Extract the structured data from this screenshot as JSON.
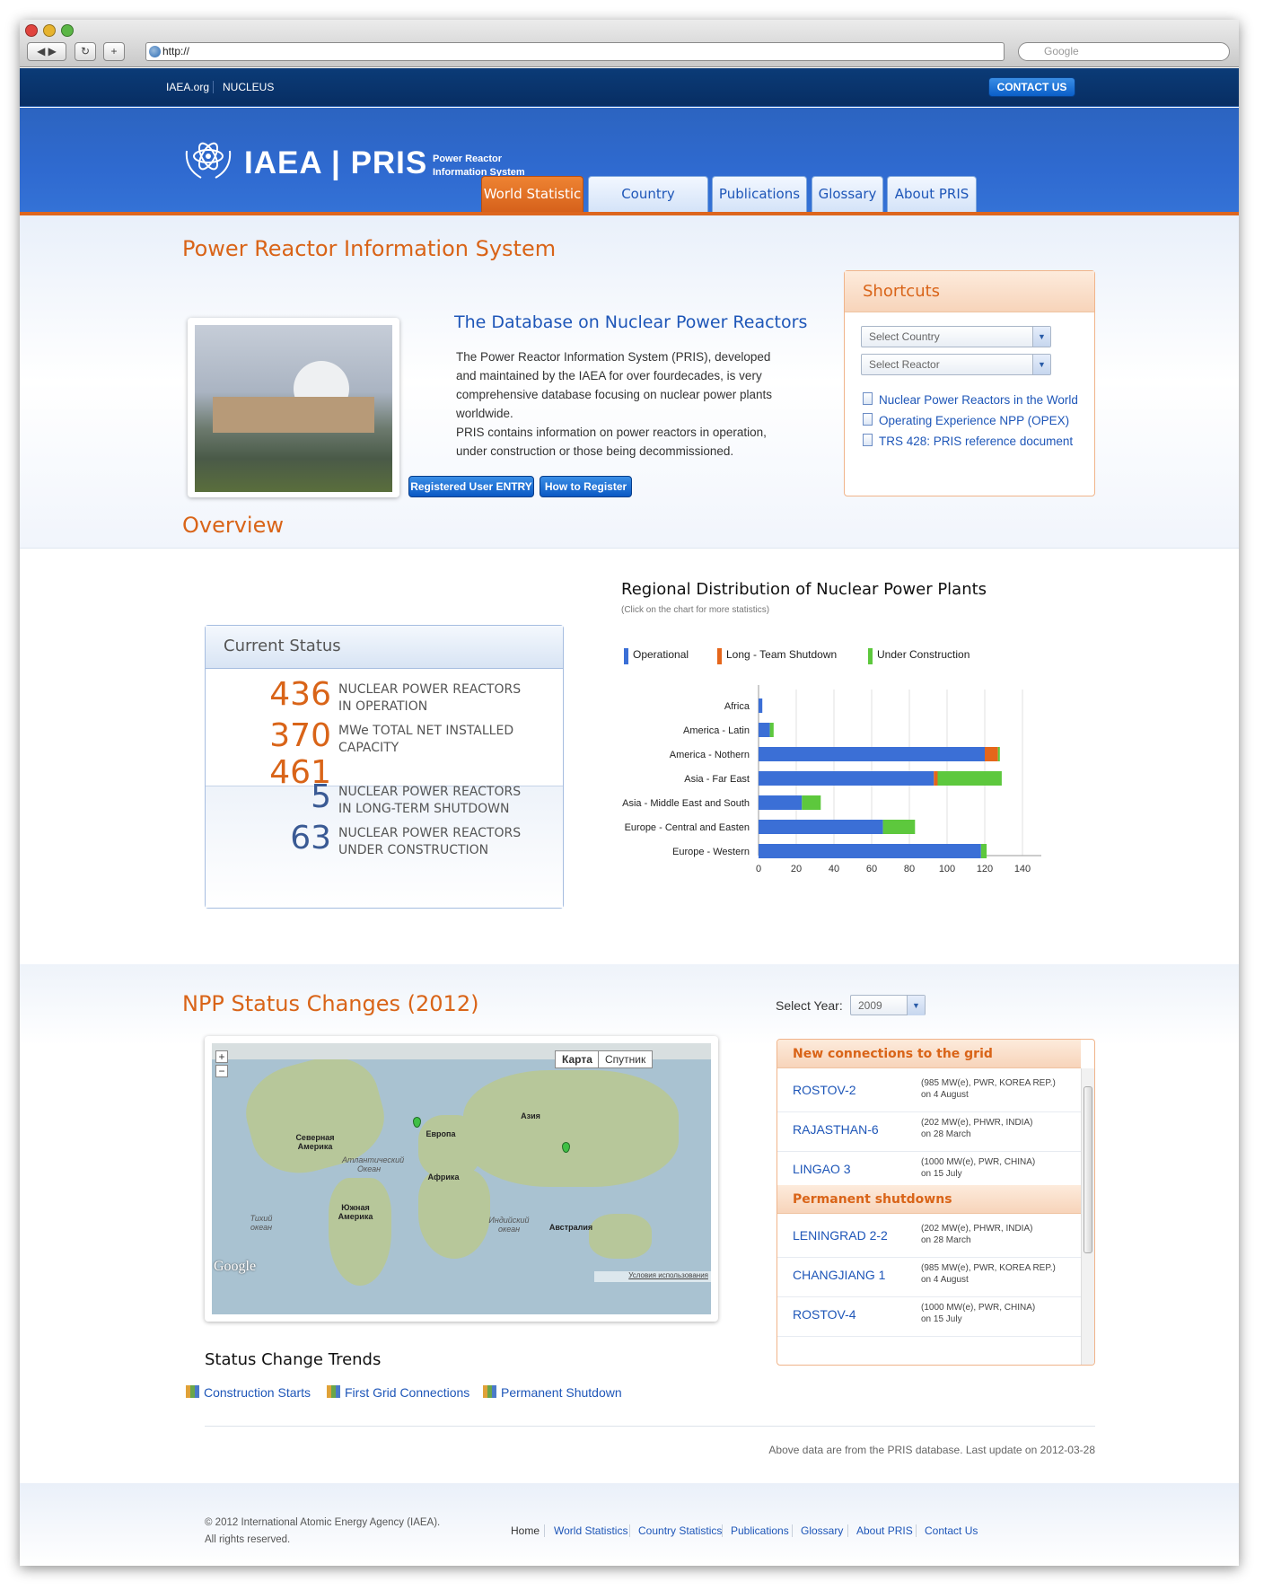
{
  "browser": {
    "url": "http://",
    "search_placeholder": "Google"
  },
  "topbar": {
    "links": [
      "IAEA.org",
      "NUCLEUS"
    ],
    "contact": "CONTACT US"
  },
  "header": {
    "logo": "IAEA | PRIS",
    "logo_sub": "Power Reactor Information System",
    "tabs": [
      "World Statistic",
      "Country Statistics",
      "Publications",
      "Glossary",
      "About PRIS"
    ],
    "active_tab": "World Statistic"
  },
  "intro": {
    "title": "Power Reactor Information System",
    "db_title": "The Database on Nuclear Power Reactors",
    "text1": "The Power Reactor Information System (PRIS), developed and maintained by the IAEA for over fourdecades, is very comprehensive database focusing on nuclear power plants worldwide.",
    "text2": "PRIS contains information on power reactors in operation, under construction or those being decommissioned.",
    "btn_register_entry": "Registered User ENTRY",
    "btn_how_to_register": "How to Register"
  },
  "shortcuts": {
    "title": "Shortcuts",
    "select_country": "Select Country",
    "select_reactor": "Select Reactor",
    "links": [
      "Nuclear Power Reactors in the World",
      "Operating Experience NPP (OPEX)",
      "TRS 428: PRIS reference document"
    ]
  },
  "overview": {
    "title": "Overview",
    "box_title": "Current Status",
    "stats": [
      {
        "num": "436",
        "label1": "NUCLEAR POWER REACTORS",
        "label2": "IN OPERATION"
      },
      {
        "num": "370 461",
        "label1": "MWe TOTAL NET INSTALLED",
        "label2": "CAPACITY"
      },
      {
        "num": "5",
        "label1": "NUCLEAR POWER REACTORS",
        "label2": "IN LONG-TERM SHUTDOWN"
      },
      {
        "num": "63",
        "label1": "NUCLEAR POWER REACTORS",
        "label2": "UNDER CONSTRUCTION"
      }
    ]
  },
  "chart_data": {
    "type": "bar",
    "stacked": true,
    "orientation": "horizontal",
    "title": "Regional Distribution of Nuclear Power Plants",
    "subtitle": "(Click on the chart for more statistics)",
    "categories": [
      "Africa",
      "America - Latin",
      "America - Nothern",
      "Asia - Far East",
      "Asia - Middle East and South",
      "Europe - Central and Easten",
      "Europe - Western"
    ],
    "series": [
      {
        "name": "Operational",
        "color": "#3b6fd6",
        "values": [
          2,
          6,
          120,
          93,
          23,
          66,
          118
        ]
      },
      {
        "name": "Long - Team Shutdown",
        "color": "#e5661b",
        "values": [
          0,
          0,
          7,
          2,
          0,
          0,
          0
        ]
      },
      {
        "name": "Under Construction",
        "color": "#5dc83d",
        "values": [
          0,
          2,
          1,
          34,
          10,
          17,
          3
        ]
      }
    ],
    "xlim": [
      0,
      150
    ],
    "xticks": [
      0,
      20,
      40,
      60,
      80,
      100,
      120,
      140
    ],
    "grid": true,
    "legend": "top"
  },
  "npp": {
    "title": "NPP Status Changes (2012)",
    "select_year_label": "Select Year:",
    "year": "2009",
    "map_btn_map": "Карта",
    "map_btn_sat": "Спутник",
    "map_terms": "Условия использования",
    "map_brand": "Google",
    "map_labels": [
      "Северная Америка",
      "Атлантический Океан",
      "Европа",
      "Азия",
      "Африка",
      "Южная Америка",
      "Тихий океан",
      "Индийский океан",
      "Австралия"
    ],
    "new_title": "New connections to the grid",
    "new": [
      {
        "name": "ROSTOV-2",
        "d1": "(985 MW(e), PWR, KOREA REP.)",
        "d2": "on 4 August"
      },
      {
        "name": "RAJASTHAN-6",
        "d1": "(202 MW(e), PHWR, INDIA)",
        "d2": "on 28 March"
      },
      {
        "name": "LINGAO 3",
        "d1": "(1000 MW(e), PWR, CHINA)",
        "d2": "on 15 July"
      }
    ],
    "shut_title": "Permanent shutdowns",
    "shut": [
      {
        "name": "LENINGRAD 2-2",
        "d1": "(202 MW(e), PHWR, INDIA)",
        "d2": "on 28 March"
      },
      {
        "name": "CHANGJIANG 1",
        "d1": "(985 MW(e), PWR, KOREA REP.)",
        "d2": "on 4 August"
      },
      {
        "name": "ROSTOV-4",
        "d1": "(1000 MW(e), PWR, CHINA)",
        "d2": "on 15 July"
      }
    ]
  },
  "trends": {
    "title": "Status Change Trends",
    "links": [
      "Construction Starts",
      "First Grid Connections",
      "Permanent Shutdown"
    ]
  },
  "update": "Above data are from the PRIS database. Last update on 2012-03-28",
  "footer": {
    "copy1": "© 2012 International Atomic Energy Agency (IAEA).",
    "copy2": "All rights reserved.",
    "links": [
      "Home",
      "World Statistics",
      "Country Statistics",
      "Publications",
      "Glossary",
      "About PRIS",
      "Contact Us"
    ]
  }
}
